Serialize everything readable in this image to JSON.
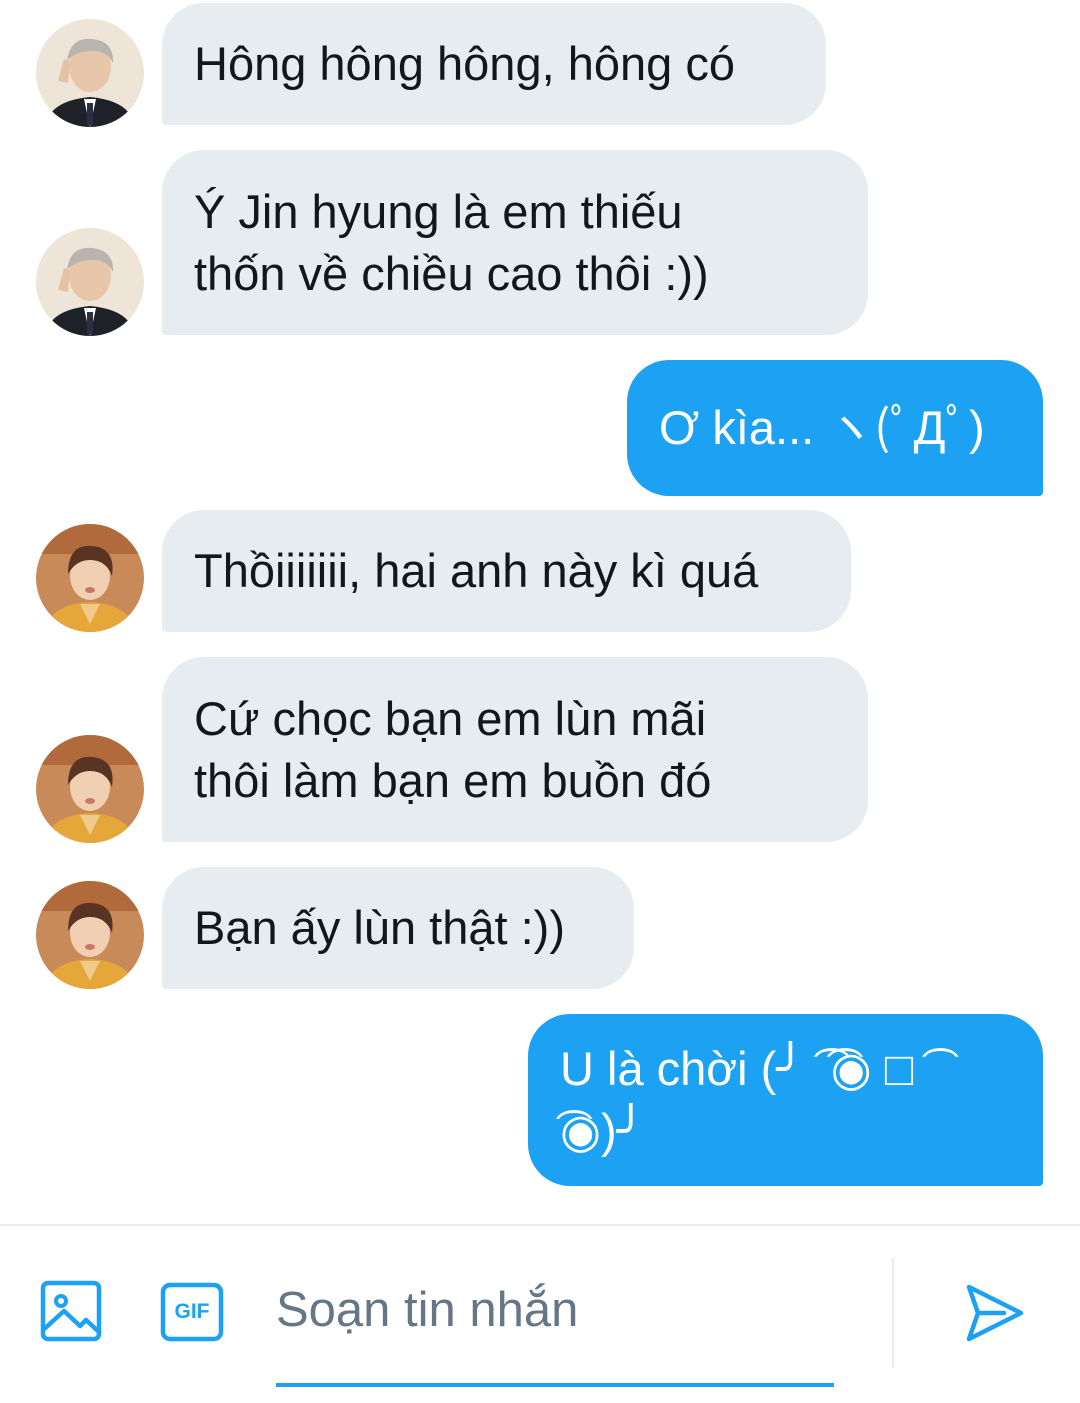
{
  "conversation": {
    "messages": [
      {
        "from": "rm",
        "text": "Hông hông hông, hông có"
      },
      {
        "from": "rm",
        "text": "Ý Jin hyung là em thiếu\nthốn về chiều cao thôi :))"
      },
      {
        "from": "me",
        "text": "Ơ kìa... ヽ(ﾟДﾟ)"
      },
      {
        "from": "v",
        "text": "Thồiiiiiii, hai anh này kì quá"
      },
      {
        "from": "v",
        "text": "Cứ chọc bạn em lùn mãi\nthôi làm bạn em buồn đó"
      },
      {
        "from": "v",
        "text": "Bạn ấy lùn thật :))"
      },
      {
        "from": "me",
        "text": "U là chời (╯ ͡ ͡◉ □ ͡ ͡◉)╯"
      }
    ]
  },
  "composer": {
    "placeholder": "Soạn tin nhắn",
    "gif_label": "GIF",
    "image_icon": "image-icon",
    "gif_icon": "gif-icon",
    "send_icon": "send-icon"
  },
  "colors": {
    "accent": "#1da1f2",
    "incoming_bubble": "#e6ecf0",
    "incoming_text": "#14171a",
    "placeholder_text": "#657786"
  }
}
